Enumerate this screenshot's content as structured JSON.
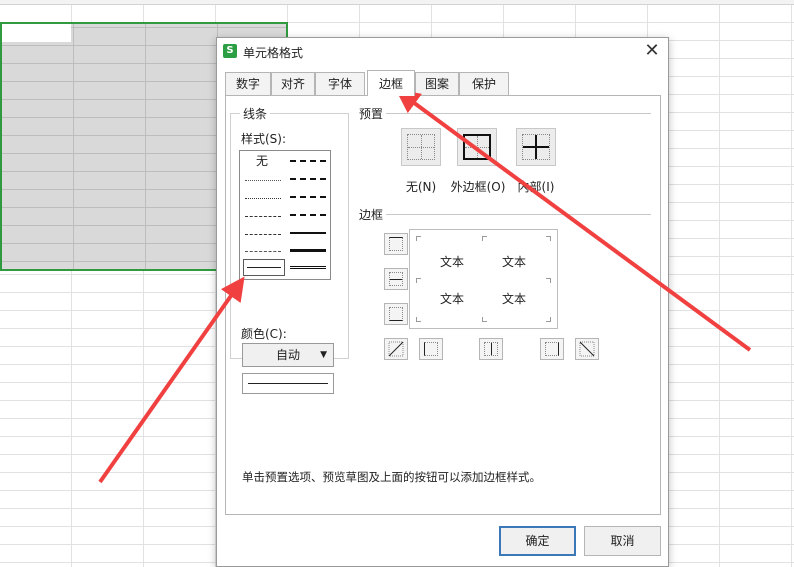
{
  "dialog": {
    "title": "单元格格式",
    "app_icon": "S",
    "tabs": [
      {
        "label": "数字"
      },
      {
        "label": "对齐"
      },
      {
        "label": "字体"
      },
      {
        "label": "边框"
      },
      {
        "label": "图案"
      },
      {
        "label": "保护"
      }
    ],
    "active_tab": "边框",
    "line_group": {
      "title": "线条",
      "style_label": "样式(S):",
      "none_label": "无",
      "color_label": "颜色(C):",
      "color_value": "自动"
    },
    "preset_group": {
      "title": "预置",
      "buttons": [
        {
          "label": "无(N)"
        },
        {
          "label": "外边框(O)"
        },
        {
          "label": "内部(I)"
        }
      ]
    },
    "border_group": {
      "title": "边框",
      "preview_text": [
        "文本",
        "文本",
        "文本",
        "文本"
      ]
    },
    "hint": "单击预置选项、预览草图及上面的按钮可以添加边框样式。",
    "ok_label": "确定",
    "cancel_label": "取消"
  },
  "colors": {
    "selection_border": "#2f9a3e",
    "selection_fill": "#d9d9d9",
    "annotation_arrow": "#f04040",
    "ok_border": "#3b78b8"
  }
}
